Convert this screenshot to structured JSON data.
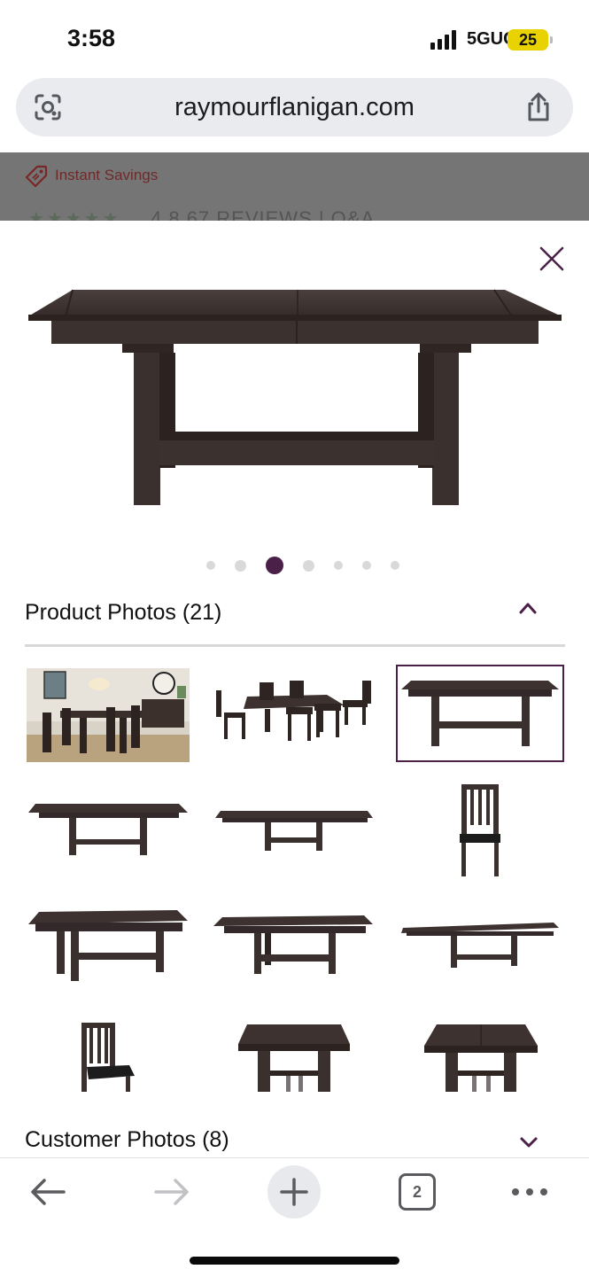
{
  "status_bar": {
    "time": "3:58",
    "network": "5GUC",
    "battery": "25"
  },
  "browser": {
    "url": "raymourflanigan.com"
  },
  "background_page": {
    "promo": "Instant Savings",
    "stars": "★★★★★",
    "rating_line": "4.8   67 REVIEWS  |  Q&A"
  },
  "modal": {
    "product_photos_title": "Product Photos (21)",
    "customer_photos_title": "Customer Photos (8)",
    "carousel": {
      "count": 7,
      "active_index": 2
    },
    "thumbnails": [
      {
        "subject": "dining room scene"
      },
      {
        "subject": "table with six chairs"
      },
      {
        "subject": "trestle table"
      },
      {
        "subject": "table extended"
      },
      {
        "subject": "table low angle"
      },
      {
        "subject": "side chair"
      },
      {
        "subject": "table angled"
      },
      {
        "subject": "table angled right"
      },
      {
        "subject": "table fully extended"
      },
      {
        "subject": "chair angled"
      },
      {
        "subject": "table end view"
      },
      {
        "subject": "table end view 2"
      }
    ],
    "selected_thumbnail": 2
  },
  "toolbar": {
    "tab_count": "2"
  },
  "colors": {
    "accent": "#4a2048",
    "wood": "#3d3230"
  },
  "icons": [
    "lens-icon",
    "share-icon",
    "price-tag-icon",
    "close-icon",
    "chevron-up-icon",
    "chevron-down-icon",
    "back-arrow-icon",
    "forward-arrow-icon",
    "plus-icon",
    "tabs-icon",
    "more-icon"
  ]
}
